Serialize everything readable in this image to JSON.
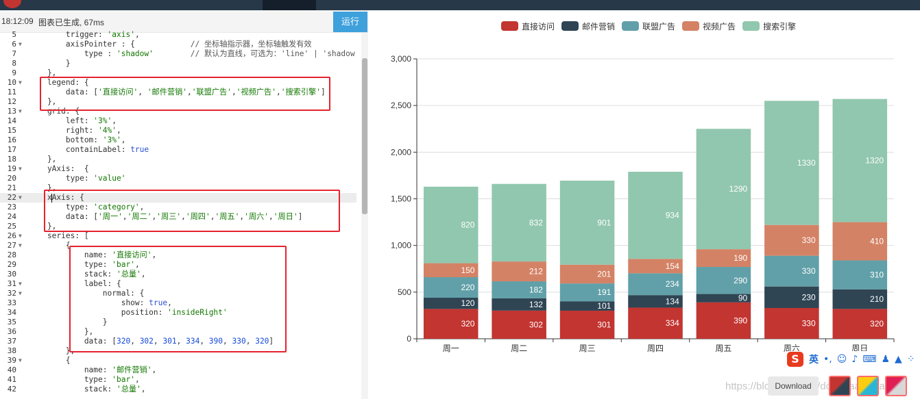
{
  "editor": {
    "status_time": "18:12:09",
    "status_msg": "图表已生成, 67ms",
    "run_label": "运行",
    "lines": [
      {
        "n": "5",
        "fold": false,
        "html": "        trigger: <span class='s'>'axis'</span>,"
      },
      {
        "n": "6",
        "fold": true,
        "html": "        axisPointer : {            <span class='c'>// 坐标轴指示器，坐标轴触发有效</span>"
      },
      {
        "n": "7",
        "fold": false,
        "html": "            type : <span class='s'>'shadow'</span>        <span class='c'>// 默认为直线，可选为：'line' | 'shadow'</span>"
      },
      {
        "n": "8",
        "fold": false,
        "html": "        }"
      },
      {
        "n": "9",
        "fold": false,
        "html": "    },"
      },
      {
        "n": "10",
        "fold": true,
        "html": "    legend: {"
      },
      {
        "n": "11",
        "fold": false,
        "html": "        data: [<span class='s'>'直接访问'</span>, <span class='s'>'邮件营销'</span>,<span class='s'>'联盟广告'</span>,<span class='s'>'视频广告'</span>,<span class='s'>'搜索引擎'</span>]"
      },
      {
        "n": "12",
        "fold": false,
        "html": "    },"
      },
      {
        "n": "13",
        "fold": true,
        "html": "    grid: {"
      },
      {
        "n": "14",
        "fold": false,
        "html": "        left: <span class='s'>'3%'</span>,"
      },
      {
        "n": "15",
        "fold": false,
        "html": "        right: <span class='s'>'4%'</span>,"
      },
      {
        "n": "16",
        "fold": false,
        "html": "        bottom: <span class='s'>'3%'</span>,"
      },
      {
        "n": "17",
        "fold": false,
        "html": "        containLabel: <span class='b'>true</span>"
      },
      {
        "n": "18",
        "fold": false,
        "html": "    },"
      },
      {
        "n": "19",
        "fold": true,
        "html": "    yAxis:  {"
      },
      {
        "n": "20",
        "fold": false,
        "html": "        type: <span class='s'>'value'</span>"
      },
      {
        "n": "21",
        "fold": false,
        "html": "    },"
      },
      {
        "n": "22",
        "fold": true,
        "html": "    x<span class='cursor'></span>Axis: {",
        "active": true
      },
      {
        "n": "23",
        "fold": false,
        "html": "        type: <span class='s'>'category'</span>,"
      },
      {
        "n": "24",
        "fold": false,
        "html": "        data: [<span class='s'>'周一'</span>,<span class='s'>'周二'</span>,<span class='s'>'周三'</span>,<span class='s'>'周四'</span>,<span class='s'>'周五'</span>,<span class='s'>'周六'</span>,<span class='s'>'周日'</span>]"
      },
      {
        "n": "25",
        "fold": false,
        "html": "    },"
      },
      {
        "n": "26",
        "fold": true,
        "html": "    series: ["
      },
      {
        "n": "27",
        "fold": true,
        "html": "        {"
      },
      {
        "n": "28",
        "fold": false,
        "html": "            name: <span class='s'>'直接访问'</span>,"
      },
      {
        "n": "29",
        "fold": false,
        "html": "            type: <span class='s'>'bar'</span>,"
      },
      {
        "n": "30",
        "fold": false,
        "html": "            stack: <span class='s'>'总量'</span>,"
      },
      {
        "n": "31",
        "fold": true,
        "html": "            label: {"
      },
      {
        "n": "32",
        "fold": true,
        "html": "                normal: {"
      },
      {
        "n": "33",
        "fold": false,
        "html": "                    show: <span class='b'>true</span>,"
      },
      {
        "n": "34",
        "fold": false,
        "html": "                    position: <span class='s'>'insideRight'</span>"
      },
      {
        "n": "35",
        "fold": false,
        "html": "                }"
      },
      {
        "n": "36",
        "fold": false,
        "html": "            },"
      },
      {
        "n": "37",
        "fold": false,
        "html": "            data: [<span class='n'>320</span>, <span class='n'>302</span>, <span class='n'>301</span>, <span class='n'>334</span>, <span class='n'>390</span>, <span class='n'>330</span>, <span class='n'>320</span>]"
      },
      {
        "n": "38",
        "fold": false,
        "html": "        },"
      },
      {
        "n": "39",
        "fold": true,
        "html": "        {"
      },
      {
        "n": "40",
        "fold": false,
        "html": "            name: <span class='s'>'邮件营销'</span>,"
      },
      {
        "n": "41",
        "fold": false,
        "html": "            type: <span class='s'>'bar'</span>,"
      },
      {
        "n": "42",
        "fold": false,
        "html": "            stack: <span class='s'>'总量'</span>,"
      }
    ]
  },
  "chart_data": {
    "type": "bar",
    "stacked": true,
    "categories": [
      "周一",
      "周二",
      "周三",
      "周四",
      "周五",
      "周六",
      "周日"
    ],
    "series": [
      {
        "name": "直接访问",
        "color": "#c23531",
        "values": [
          320,
          302,
          301,
          334,
          390,
          330,
          320
        ]
      },
      {
        "name": "邮件营销",
        "color": "#2f4554",
        "values": [
          120,
          132,
          101,
          134,
          90,
          230,
          210
        ]
      },
      {
        "name": "联盟广告",
        "color": "#61a0a8",
        "values": [
          220,
          182,
          191,
          234,
          290,
          330,
          310
        ]
      },
      {
        "name": "视频广告",
        "color": "#d48265",
        "values": [
          150,
          212,
          201,
          154,
          190,
          330,
          410
        ]
      },
      {
        "name": "搜索引擎",
        "color": "#91c7ae",
        "values": [
          820,
          832,
          901,
          934,
          1290,
          1330,
          1320
        ]
      }
    ],
    "ylim": [
      0,
      3000
    ],
    "yticks": [
      "0",
      "500",
      "1,000",
      "1,500",
      "2,000",
      "2,500",
      "3,000"
    ],
    "grid": true,
    "legend_position": "top"
  },
  "toolbar": {
    "download_label": "Download"
  },
  "ime": {
    "logo": "S",
    "mode": "英"
  },
  "watermark": "https://blog.csdn.net/dongdaandxiaomi"
}
